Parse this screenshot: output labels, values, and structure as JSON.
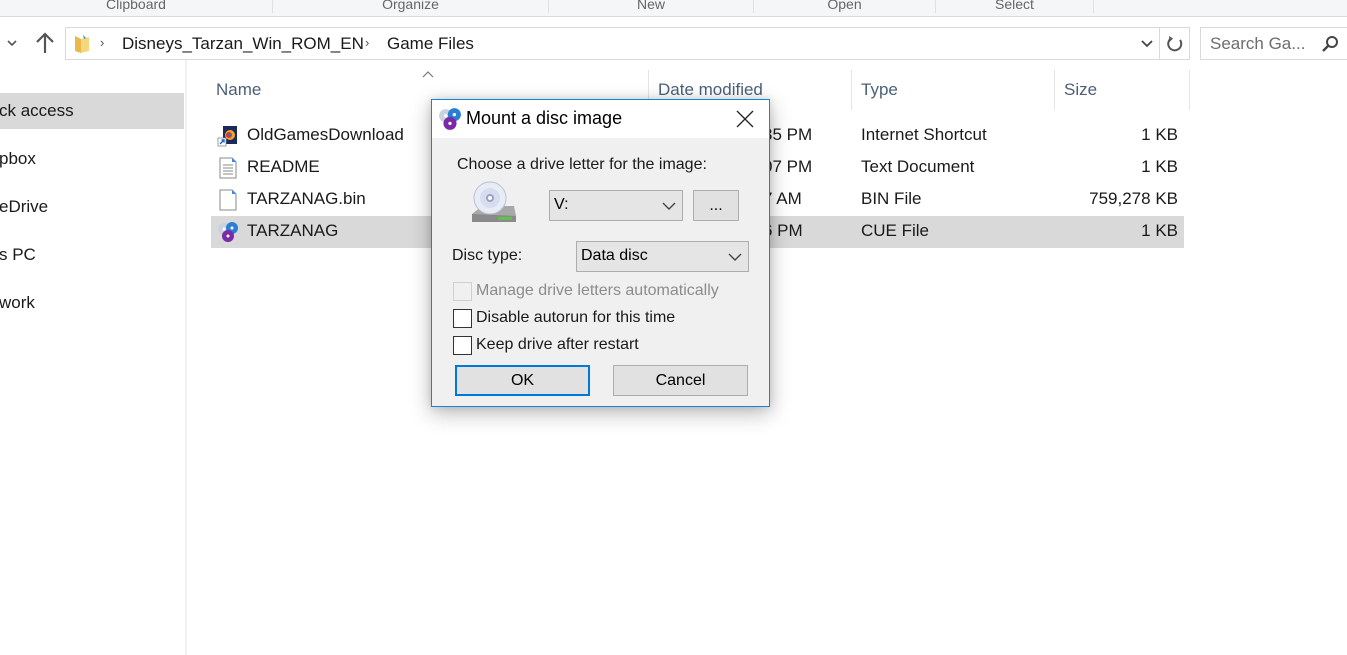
{
  "ribbon": {
    "groups": [
      "Clipboard",
      "Organize",
      "New",
      "Open",
      "Select"
    ]
  },
  "address_bar": {
    "breadcrumbs": [
      "Disneys_Tarzan_Win_ROM_EN",
      "Game Files"
    ],
    "search_placeholder": "Search Ga...",
    "icons": [
      "chevron-down-icon",
      "up-arrow-icon",
      "folder-icon",
      "refresh-icon",
      "search-icon"
    ]
  },
  "sidebar": {
    "items": [
      {
        "label": "ck access",
        "active": true
      },
      {
        "label": "pbox",
        "active": false
      },
      {
        "label": "eDrive",
        "active": false
      },
      {
        "label": "s PC",
        "active": false
      },
      {
        "label": "work",
        "active": false
      }
    ]
  },
  "filelist": {
    "columns": [
      "Name",
      "Date modified",
      "Type",
      "Size"
    ],
    "sort_column": "Name",
    "rows": [
      {
        "name": "OldGamesDownload",
        "date": "35 PM",
        "type": "Internet Shortcut",
        "size": "1 KB",
        "icon": "internet-shortcut-icon",
        "selected": false
      },
      {
        "name": "README",
        "date": "07 PM",
        "type": "Text Document",
        "size": "1 KB",
        "icon": "text-document-icon",
        "selected": false
      },
      {
        "name": "TARZANAG.bin",
        "date": "7 AM",
        "type": "BIN File",
        "size": "759,278 KB",
        "icon": "blank-file-icon",
        "selected": false
      },
      {
        "name": "TARZANAG",
        "date": "6 PM",
        "type": "CUE File",
        "size": "1 KB",
        "icon": "disc-image-icon",
        "selected": true
      }
    ]
  },
  "dialog": {
    "title": "Mount a disc image",
    "drive_letter_label": "Choose a drive letter for the image:",
    "drive_letter_value": "V:",
    "browse_label": "...",
    "disc_type_label": "Disc type:",
    "disc_type_value": "Data disc",
    "checkboxes": [
      {
        "label": "Manage drive letters automatically",
        "checked": false,
        "disabled": true
      },
      {
        "label": "Disable autorun for this time",
        "checked": false,
        "disabled": false
      },
      {
        "label": "Keep drive after restart",
        "checked": false,
        "disabled": false
      }
    ],
    "ok_label": "OK",
    "cancel_label": "Cancel"
  },
  "colors": {
    "accent": "#0078d7",
    "selection": "#d9d9d9",
    "column_header": "#4c607a",
    "dialog_bg": "#f0f0f0"
  }
}
